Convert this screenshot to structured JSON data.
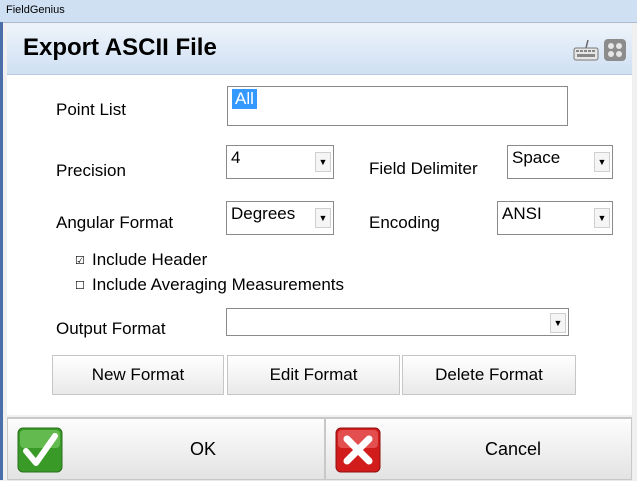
{
  "window": {
    "app_name": "FieldGenius"
  },
  "header": {
    "title": "Export ASCII File",
    "keyboard_icon": "keyboard-icon",
    "menu_icon": "grid-icon"
  },
  "form": {
    "point_list": {
      "label": "Point List",
      "value": "All"
    },
    "precision": {
      "label": "Precision",
      "value": "4"
    },
    "field_delimiter": {
      "label": "Field Delimiter",
      "value": "Space"
    },
    "angular_format": {
      "label": "Angular Format",
      "value": "Degrees"
    },
    "encoding": {
      "label": "Encoding",
      "value": "ANSI"
    },
    "include_header": {
      "label": "Include Header",
      "checked": true
    },
    "include_averaging": {
      "label": "Include Averaging Measurements",
      "checked": false
    },
    "output_format": {
      "label": "Output Format",
      "value": ""
    }
  },
  "buttons": {
    "new_format": "New Format",
    "edit_format": "Edit Format",
    "delete_format": "Delete Format"
  },
  "footer": {
    "ok": "OK",
    "cancel": "Cancel"
  },
  "colors": {
    "selection": "#3399ff",
    "title_bar": "#cfe0f3",
    "ok_green": "#3a9a28",
    "cancel_red": "#d21c1c"
  }
}
